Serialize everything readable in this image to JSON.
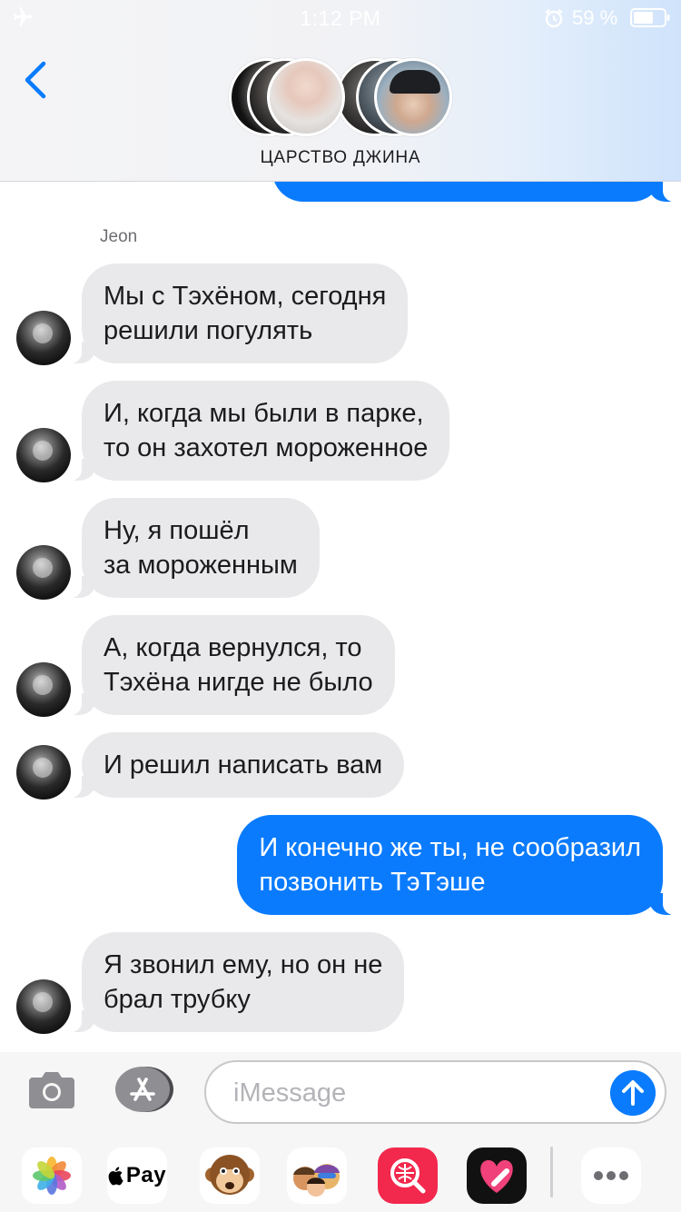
{
  "status_bar": {
    "time": "1:12 PM",
    "battery_percent": "59 %",
    "icons": [
      "airplane-icon",
      "alarm-icon",
      "battery-icon"
    ]
  },
  "header": {
    "back_icon": "chevron-left-icon",
    "group_name": "ЦАРСТВО ДЖИНА",
    "participant_avatars": 6
  },
  "conversation": {
    "sender_name": "Jeon",
    "messages": [
      {
        "from": "Jeon",
        "direction": "incoming",
        "text": "Мы с Тэхёном, сегодня\nрешили погулять"
      },
      {
        "from": "Jeon",
        "direction": "incoming",
        "text": "И, когда мы были в парке,\nто он захотел мороженное"
      },
      {
        "from": "Jeon",
        "direction": "incoming",
        "text": "Ну, я пошёл\nза мороженным"
      },
      {
        "from": "Jeon",
        "direction": "incoming",
        "text": "А, когда вернулся, то\nТэхёна нигде не было"
      },
      {
        "from": "Jeon",
        "direction": "incoming",
        "text": "И решил написать вам"
      },
      {
        "from": "me",
        "direction": "outgoing",
        "text": "И конечно же ты, не сообразил\nпозвонить ТэТэше"
      },
      {
        "from": "Jeon",
        "direction": "incoming",
        "text": "Я звонил ему, но он не\nбрал трубку"
      }
    ]
  },
  "input_bar": {
    "camera_icon": "camera-icon",
    "appstore_icon": "app-store-icon",
    "placeholder": "iMessage",
    "value": "",
    "send_icon": "arrow-up-icon"
  },
  "app_drawer": {
    "apps": [
      "photos-icon",
      "Pay",
      "monkey-memoji-icon",
      "memoji-icon",
      "search-web-icon",
      "heart-sticker-icon",
      "more-icon"
    ],
    "pay_label": "Pay"
  },
  "colors": {
    "outgoing_bubble": "#0a7bfd",
    "incoming_bubble": "#e9e9eb",
    "header_bg": "#f1f2f5"
  }
}
